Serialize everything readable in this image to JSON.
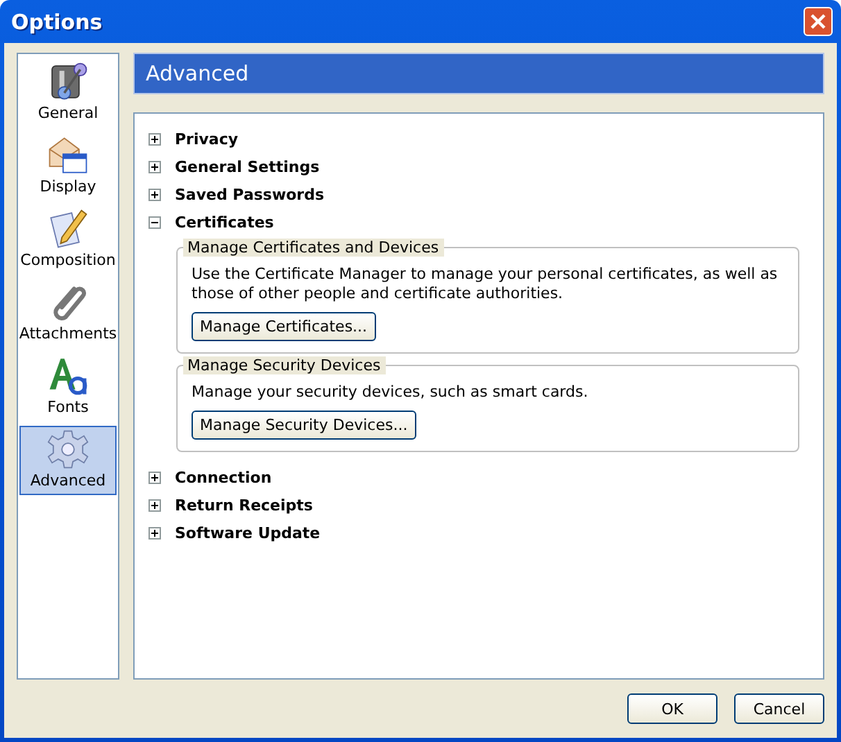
{
  "window": {
    "title": "Options"
  },
  "sidebar": {
    "items": [
      {
        "kind": "general",
        "label": "General",
        "selected": false
      },
      {
        "kind": "display",
        "label": "Display",
        "selected": false
      },
      {
        "kind": "composition",
        "label": "Composition",
        "selected": false
      },
      {
        "kind": "attachments",
        "label": "Attachments",
        "selected": false
      },
      {
        "kind": "fonts",
        "label": "Fonts",
        "selected": false
      },
      {
        "kind": "advanced",
        "label": "Advanced",
        "selected": true
      }
    ]
  },
  "panel": {
    "title": "Advanced",
    "sections": [
      {
        "label": "Privacy",
        "expanded": false
      },
      {
        "label": "General Settings",
        "expanded": false
      },
      {
        "label": "Saved Passwords",
        "expanded": false
      },
      {
        "label": "Certificates",
        "expanded": true,
        "groups": [
          {
            "caption": "Manage Certificates and Devices",
            "text": "Use the Certificate Manager to manage your personal certificates, as well as those of other people and certificate authorities.",
            "button": "Manage Certificates..."
          },
          {
            "caption": "Manage Security Devices",
            "text": "Manage your security devices, such as smart cards.",
            "button": "Manage Security Devices..."
          }
        ]
      },
      {
        "label": "Connection",
        "expanded": false
      },
      {
        "label": "Return Receipts",
        "expanded": false
      },
      {
        "label": "Software Update",
        "expanded": false
      }
    ]
  },
  "buttons": [
    "OK",
    "Cancel"
  ]
}
